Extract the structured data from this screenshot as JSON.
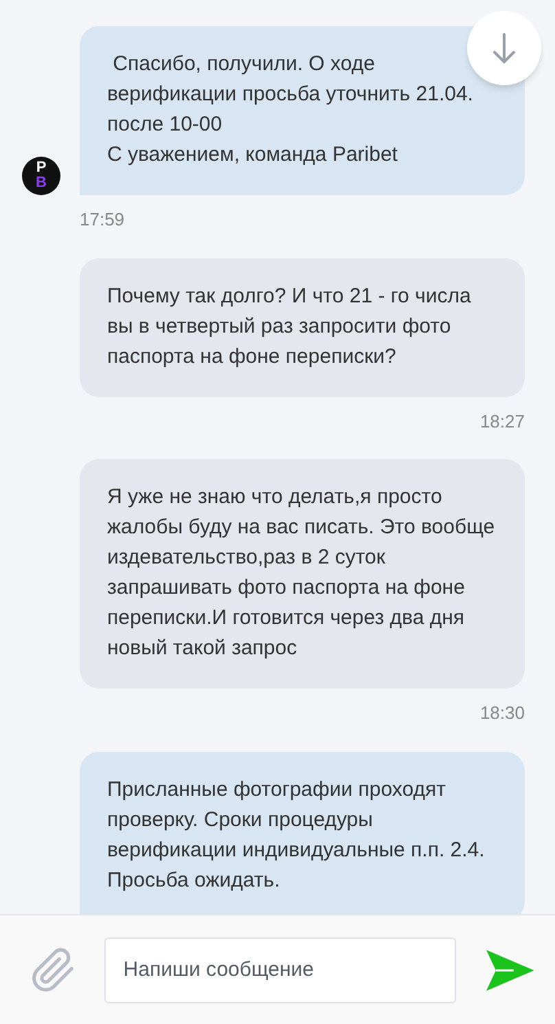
{
  "messages": [
    {
      "kind": "incoming",
      "text": " Спасибо, получили. О ходе верификации просьба уточнить 21.04. после 10-00\nС уважением, команда Paribet",
      "time": "17:59",
      "avatar": [
        "P",
        "B"
      ]
    },
    {
      "kind": "outgoing",
      "text": "Почему так долго? И что 21 - го числа вы в четвертый раз запросити фото паспорта на фоне переписки?",
      "time": "18:27"
    },
    {
      "kind": "outgoing",
      "text": "Я уже не знаю что делать,я просто жалобы буду на вас писать. Это вообще издевательство,раз в 2 суток запрашивать фото паспорта на фоне переписки.И готовится через два дня новый такой запрос",
      "time": "18:30"
    },
    {
      "kind": "incoming",
      "text": "Присланные фотографии проходят проверку. Сроки процедуры верификации индивидуальные п.п. 2.4.\nПросьба ожидать."
    }
  ],
  "composer": {
    "placeholder": "Напиши сообщение"
  }
}
